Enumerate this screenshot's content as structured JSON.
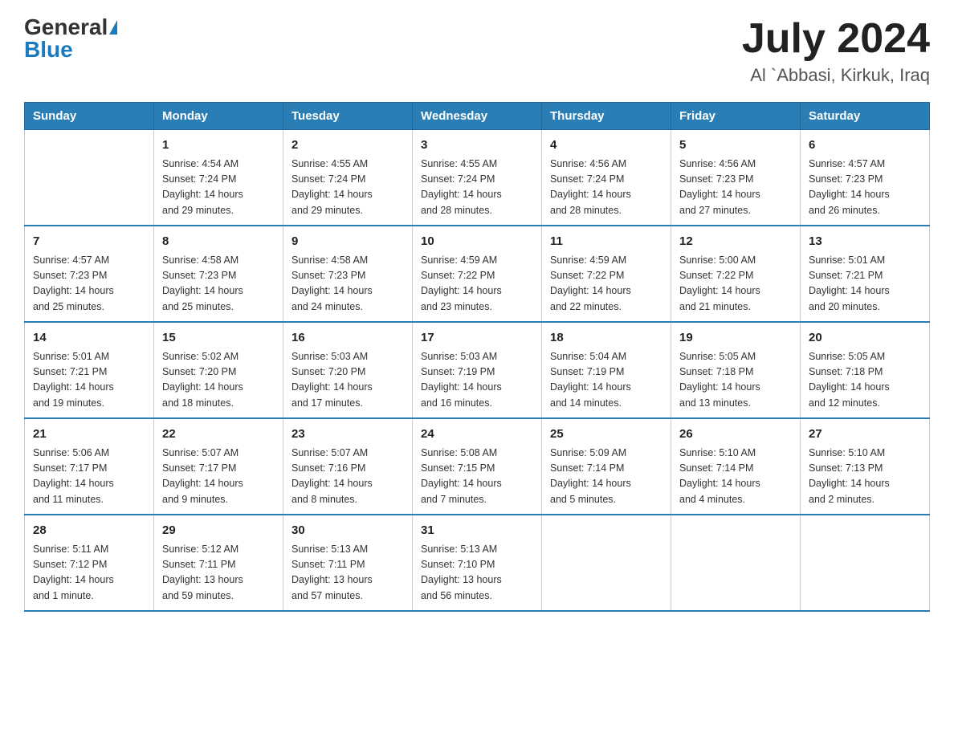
{
  "header": {
    "logo_general": "General",
    "logo_blue": "Blue",
    "month_year": "July 2024",
    "location": "Al `Abbasi, Kirkuk, Iraq"
  },
  "days_of_week": [
    "Sunday",
    "Monday",
    "Tuesday",
    "Wednesday",
    "Thursday",
    "Friday",
    "Saturday"
  ],
  "weeks": [
    [
      {
        "day": "",
        "info": ""
      },
      {
        "day": "1",
        "info": "Sunrise: 4:54 AM\nSunset: 7:24 PM\nDaylight: 14 hours\nand 29 minutes."
      },
      {
        "day": "2",
        "info": "Sunrise: 4:55 AM\nSunset: 7:24 PM\nDaylight: 14 hours\nand 29 minutes."
      },
      {
        "day": "3",
        "info": "Sunrise: 4:55 AM\nSunset: 7:24 PM\nDaylight: 14 hours\nand 28 minutes."
      },
      {
        "day": "4",
        "info": "Sunrise: 4:56 AM\nSunset: 7:24 PM\nDaylight: 14 hours\nand 28 minutes."
      },
      {
        "day": "5",
        "info": "Sunrise: 4:56 AM\nSunset: 7:23 PM\nDaylight: 14 hours\nand 27 minutes."
      },
      {
        "day": "6",
        "info": "Sunrise: 4:57 AM\nSunset: 7:23 PM\nDaylight: 14 hours\nand 26 minutes."
      }
    ],
    [
      {
        "day": "7",
        "info": "Sunrise: 4:57 AM\nSunset: 7:23 PM\nDaylight: 14 hours\nand 25 minutes."
      },
      {
        "day": "8",
        "info": "Sunrise: 4:58 AM\nSunset: 7:23 PM\nDaylight: 14 hours\nand 25 minutes."
      },
      {
        "day": "9",
        "info": "Sunrise: 4:58 AM\nSunset: 7:23 PM\nDaylight: 14 hours\nand 24 minutes."
      },
      {
        "day": "10",
        "info": "Sunrise: 4:59 AM\nSunset: 7:22 PM\nDaylight: 14 hours\nand 23 minutes."
      },
      {
        "day": "11",
        "info": "Sunrise: 4:59 AM\nSunset: 7:22 PM\nDaylight: 14 hours\nand 22 minutes."
      },
      {
        "day": "12",
        "info": "Sunrise: 5:00 AM\nSunset: 7:22 PM\nDaylight: 14 hours\nand 21 minutes."
      },
      {
        "day": "13",
        "info": "Sunrise: 5:01 AM\nSunset: 7:21 PM\nDaylight: 14 hours\nand 20 minutes."
      }
    ],
    [
      {
        "day": "14",
        "info": "Sunrise: 5:01 AM\nSunset: 7:21 PM\nDaylight: 14 hours\nand 19 minutes."
      },
      {
        "day": "15",
        "info": "Sunrise: 5:02 AM\nSunset: 7:20 PM\nDaylight: 14 hours\nand 18 minutes."
      },
      {
        "day": "16",
        "info": "Sunrise: 5:03 AM\nSunset: 7:20 PM\nDaylight: 14 hours\nand 17 minutes."
      },
      {
        "day": "17",
        "info": "Sunrise: 5:03 AM\nSunset: 7:19 PM\nDaylight: 14 hours\nand 16 minutes."
      },
      {
        "day": "18",
        "info": "Sunrise: 5:04 AM\nSunset: 7:19 PM\nDaylight: 14 hours\nand 14 minutes."
      },
      {
        "day": "19",
        "info": "Sunrise: 5:05 AM\nSunset: 7:18 PM\nDaylight: 14 hours\nand 13 minutes."
      },
      {
        "day": "20",
        "info": "Sunrise: 5:05 AM\nSunset: 7:18 PM\nDaylight: 14 hours\nand 12 minutes."
      }
    ],
    [
      {
        "day": "21",
        "info": "Sunrise: 5:06 AM\nSunset: 7:17 PM\nDaylight: 14 hours\nand 11 minutes."
      },
      {
        "day": "22",
        "info": "Sunrise: 5:07 AM\nSunset: 7:17 PM\nDaylight: 14 hours\nand 9 minutes."
      },
      {
        "day": "23",
        "info": "Sunrise: 5:07 AM\nSunset: 7:16 PM\nDaylight: 14 hours\nand 8 minutes."
      },
      {
        "day": "24",
        "info": "Sunrise: 5:08 AM\nSunset: 7:15 PM\nDaylight: 14 hours\nand 7 minutes."
      },
      {
        "day": "25",
        "info": "Sunrise: 5:09 AM\nSunset: 7:14 PM\nDaylight: 14 hours\nand 5 minutes."
      },
      {
        "day": "26",
        "info": "Sunrise: 5:10 AM\nSunset: 7:14 PM\nDaylight: 14 hours\nand 4 minutes."
      },
      {
        "day": "27",
        "info": "Sunrise: 5:10 AM\nSunset: 7:13 PM\nDaylight: 14 hours\nand 2 minutes."
      }
    ],
    [
      {
        "day": "28",
        "info": "Sunrise: 5:11 AM\nSunset: 7:12 PM\nDaylight: 14 hours\nand 1 minute."
      },
      {
        "day": "29",
        "info": "Sunrise: 5:12 AM\nSunset: 7:11 PM\nDaylight: 13 hours\nand 59 minutes."
      },
      {
        "day": "30",
        "info": "Sunrise: 5:13 AM\nSunset: 7:11 PM\nDaylight: 13 hours\nand 57 minutes."
      },
      {
        "day": "31",
        "info": "Sunrise: 5:13 AM\nSunset: 7:10 PM\nDaylight: 13 hours\nand 56 minutes."
      },
      {
        "day": "",
        "info": ""
      },
      {
        "day": "",
        "info": ""
      },
      {
        "day": "",
        "info": ""
      }
    ]
  ]
}
